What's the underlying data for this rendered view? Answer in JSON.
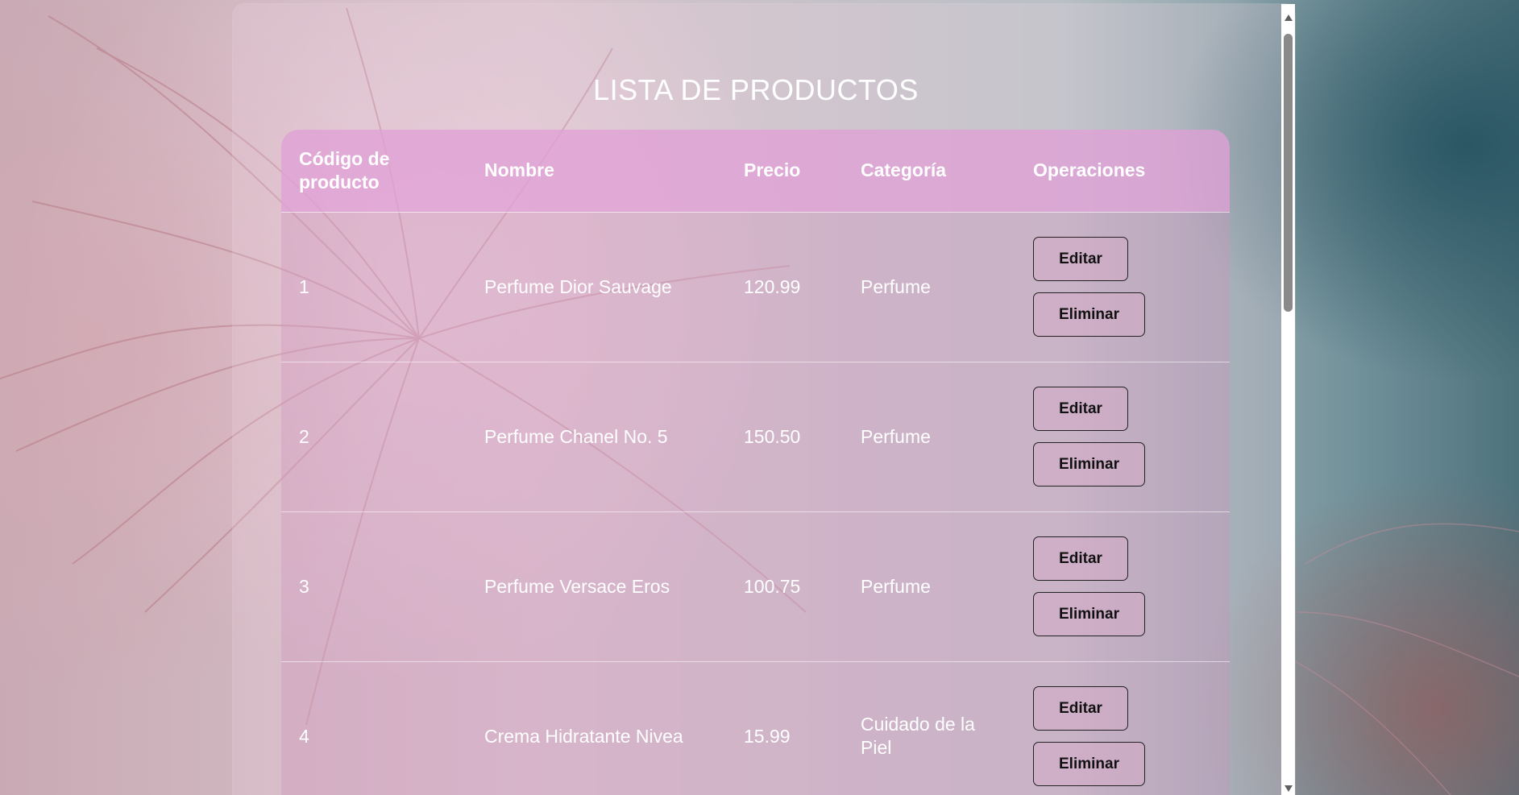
{
  "page": {
    "title": "LISTA DE PRODUCTOS"
  },
  "table": {
    "headers": {
      "code": "Código de producto",
      "name": "Nombre",
      "price": "Precio",
      "category": "Categoría",
      "operations": "Operaciones"
    },
    "rows": [
      {
        "code": "1",
        "name": "Perfume Dior Sauvage",
        "price": "120.99",
        "category": "Perfume"
      },
      {
        "code": "2",
        "name": "Perfume Chanel No. 5",
        "price": "150.50",
        "category": "Perfume"
      },
      {
        "code": "3",
        "name": "Perfume Versace Eros",
        "price": "100.75",
        "category": "Perfume"
      },
      {
        "code": "4",
        "name": "Crema Hidratante Nivea",
        "price": "15.99",
        "category": "Cuidado de la Piel"
      }
    ],
    "edit_label": "Editar",
    "delete_label": "Eliminar"
  },
  "colors": {
    "header_bg": "#E0A0D6",
    "text": "#FFFFFF",
    "scrollbar_thumb": "#8A8A8A"
  },
  "icons": {
    "scroll_up": "triangle-up-icon",
    "scroll_down": "triangle-down-icon"
  }
}
